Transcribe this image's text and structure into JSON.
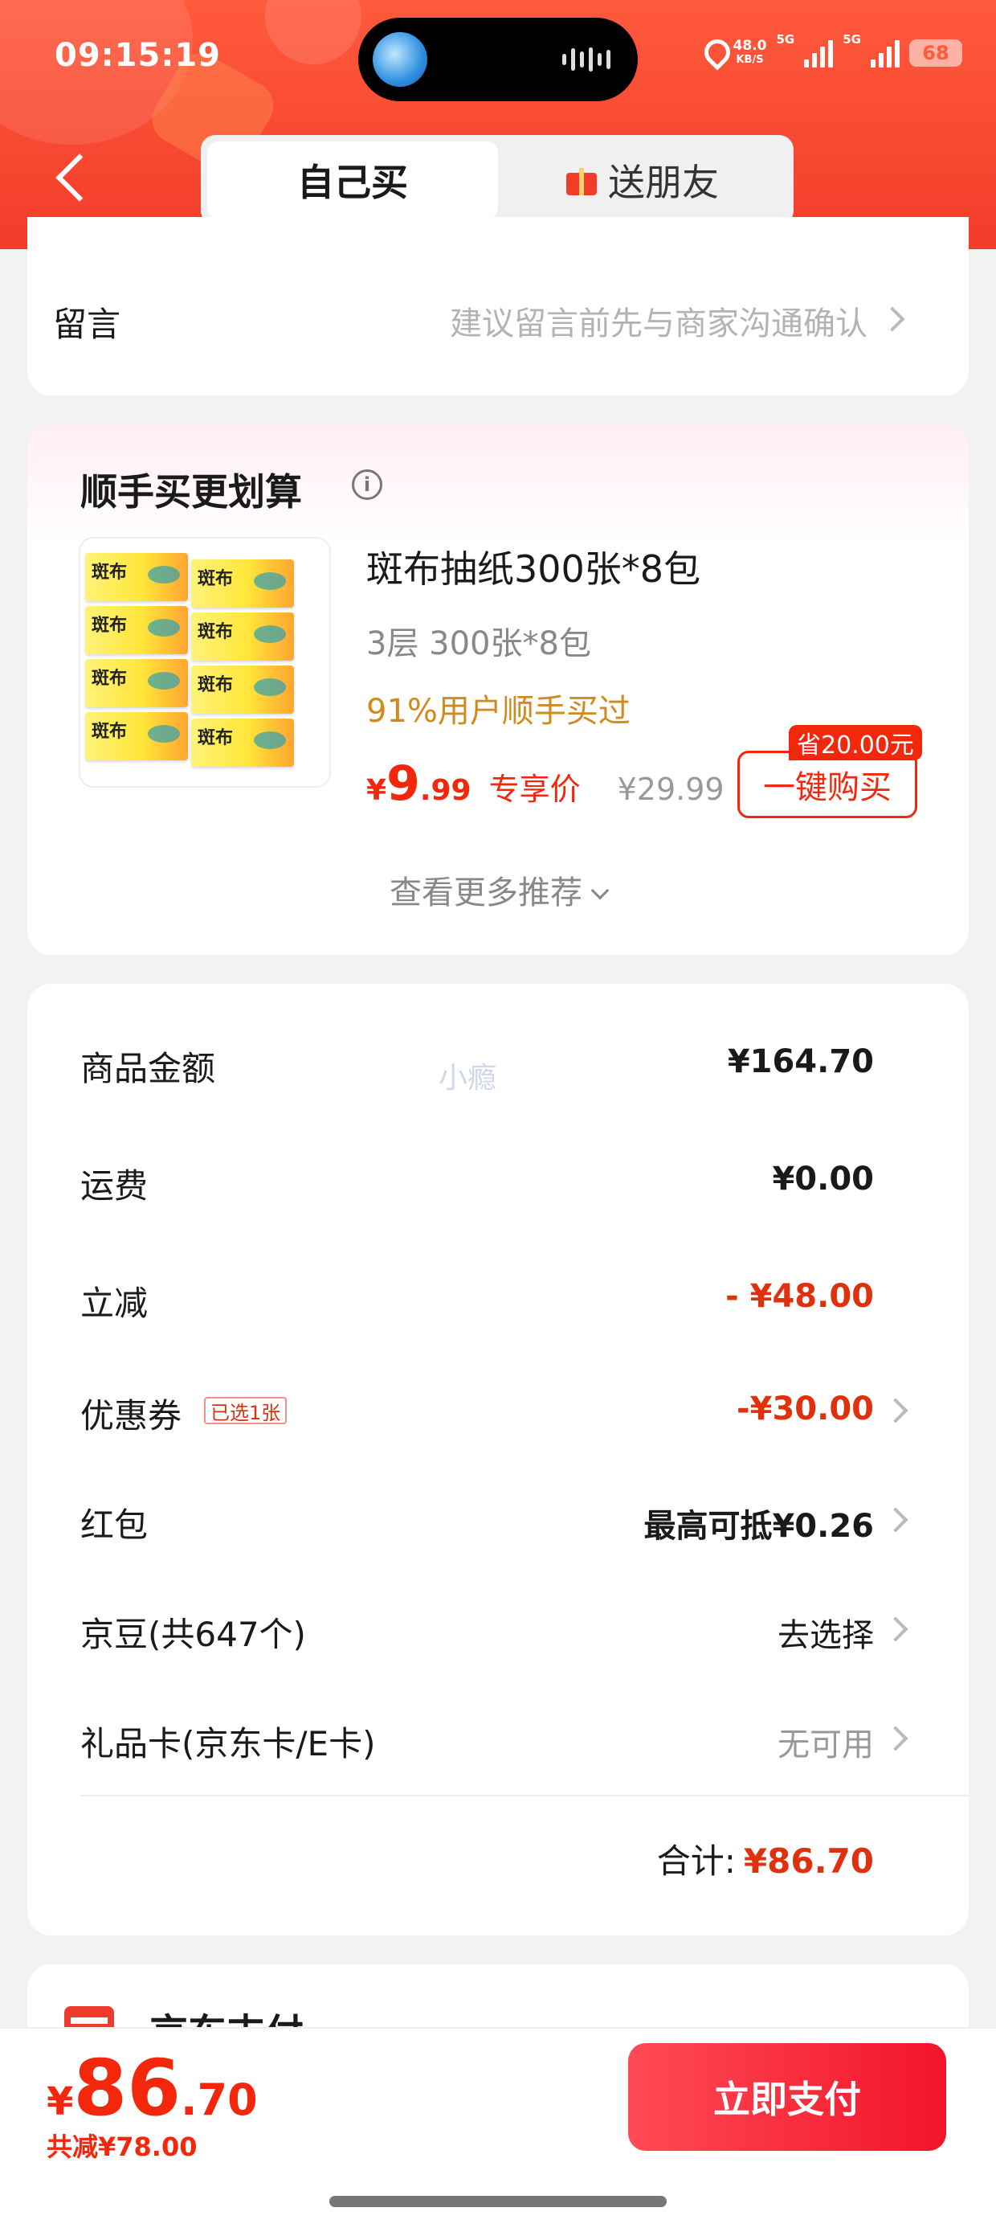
{
  "status_bar": {
    "time": "09:15:19",
    "net_speed_value": "48.0",
    "net_speed_unit": "KB/S",
    "sim1_label": "5G",
    "sim2_label": "5G",
    "battery": "68"
  },
  "header": {
    "tab_self": "自己买",
    "tab_gift": "送朋友"
  },
  "note": {
    "label": "留言",
    "hint": "建议留言前先与商家沟通确认"
  },
  "recommend": {
    "title": "顺手买更划算",
    "info_icon": "i",
    "product": {
      "name": "斑布抽纸300张*8包",
      "spec": "3层 300张*8包",
      "stat": "91%用户顺手买过",
      "price_yen": "¥",
      "price_int": "9",
      "price_dec": ".99",
      "price_tag": "专享价",
      "old_price": "¥29.99",
      "save_badge": "省20.00元",
      "buy_label": "一键购买"
    },
    "more_label": "查看更多推荐"
  },
  "summary": {
    "watermark": "小瘾",
    "rows": [
      {
        "label": "商品金额",
        "value": "¥164.70"
      },
      {
        "label": "运费",
        "value": "¥0.00"
      },
      {
        "label": "立减",
        "value": "- ¥48.00"
      },
      {
        "label": "优惠券",
        "value": "-¥30.00",
        "badge": "已选1张"
      },
      {
        "label": "红包",
        "value": "最高可抵¥0.26"
      },
      {
        "label": "京豆(共647个)",
        "value": "去选择"
      },
      {
        "label": "礼品卡(京东卡/E卡)",
        "value": "无可用"
      }
    ],
    "total_label": "合计:",
    "total_value": "¥86.70"
  },
  "payment": {
    "method_title": "京东支付"
  },
  "bottom_bar": {
    "price_yen": "¥",
    "price_int": "86",
    "price_dec": ".70",
    "saved": "共减¥78.00",
    "pay_label": "立即支付"
  },
  "colors": {
    "brand_red": "#f2270c",
    "header_red": "#f23c2a",
    "coupon_orange": "#d18a1e"
  },
  "icons": [
    "back-chevron-icon",
    "gift-icon",
    "info-icon",
    "chevron-right-icon",
    "chevron-down-icon",
    "jd-pay-icon",
    "location-icon",
    "signal-icon",
    "battery-icon"
  ]
}
